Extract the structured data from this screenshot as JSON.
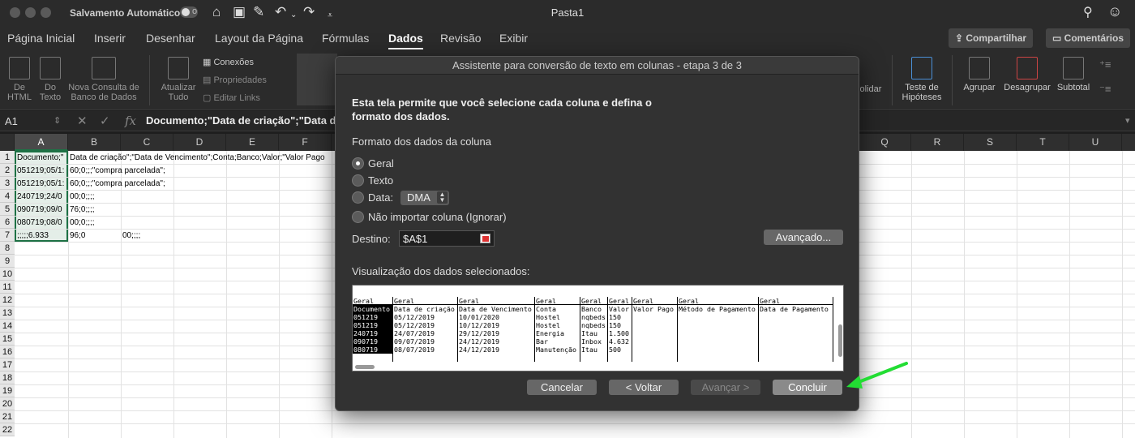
{
  "titlebar": {
    "autosave_label": "Salvamento Automático",
    "autosave_state": "o",
    "doc_title": "Pasta1"
  },
  "tabs": [
    "Página Inicial",
    "Inserir",
    "Desenhar",
    "Layout da Página",
    "Fórmulas",
    "Dados",
    "Revisão",
    "Exibir"
  ],
  "active_tab": "Dados",
  "top_buttons": {
    "share": "Compartilhar",
    "comments": "Comentários"
  },
  "ribbon": {
    "from_html": "De\nHTML",
    "from_text": "Do\nTexto",
    "new_query": "Nova Consulta de\nBanco de Dados",
    "refresh_all": "Atualizar\nTudo",
    "connections": "Conexões",
    "properties": "Propriedades",
    "edit_links": "Editar Links",
    "consolidate": "olidar",
    "whatif": "Teste de\nHipóteses",
    "group": "Agrupar",
    "ungroup": "Desagrupar",
    "subtotal": "Subtotal"
  },
  "formula_bar": {
    "name_box": "A1",
    "fx": "fx",
    "formula": "Documento;\"Data de criação\";\"Data de"
  },
  "columns": [
    "A",
    "B",
    "C",
    "D",
    "E",
    "F",
    "Q",
    "R",
    "S",
    "T",
    "U"
  ],
  "rows": [
    "1",
    "2",
    "3",
    "4",
    "5",
    "6",
    "7",
    "8",
    "9",
    "10",
    "11",
    "12",
    "13",
    "14",
    "15",
    "16",
    "17",
    "18",
    "19",
    "20",
    "21",
    "22"
  ],
  "cells": {
    "A1": "Documento;\"",
    "B1": "Data de criação\";\"Data de Vencimento\";Conta;Banco;Valor;\"Valor Pago",
    "A2": "051219;05/1:",
    "B2": "60;0;;;\"compra parcelada\";",
    "A3": "051219;05/1:",
    "B3": "60;0;;;\"compra parcelada\";",
    "A4": "240719;24/0",
    "B4": "00;0;;;;",
    "A5": "090719;09/0",
    "B5": "76;0;;;;",
    "A6": "080719;08/0",
    "B6": "00;0;;;;",
    "A7": ";;;;;6.933",
    "B7": "96;0",
    "C7": "00;;;;"
  },
  "dialog": {
    "title": "Assistente para conversão de texto em colunas - etapa 3 de 3",
    "description": "Esta tela permite que você selecione cada coluna e defina o formato dos dados.",
    "format_label": "Formato dos dados da coluna",
    "options": {
      "general": "Geral",
      "text": "Texto",
      "date": "Data:",
      "skip": "Não importar coluna (Ignorar)"
    },
    "selected_option": "Geral",
    "date_format": "DMA",
    "destination_label": "Destino:",
    "destination_value": "$A$1",
    "advanced_button": "Avançado...",
    "preview_label": "Visualização dos dados selecionados:",
    "preview": {
      "columns": [
        {
          "header": "Geral",
          "cells": [
            "Documento",
            "051219",
            "051219",
            "240719",
            "090719",
            "080719"
          ]
        },
        {
          "header": "Geral",
          "cells": [
            "Data de criação",
            "05/12/2019",
            "05/12/2019",
            "24/07/2019",
            "09/07/2019",
            "08/07/2019"
          ]
        },
        {
          "header": "Geral",
          "cells": [
            "Data de Vencimento",
            "10/01/2020",
            "10/12/2019",
            "29/12/2019",
            "24/12/2019",
            "24/12/2019"
          ]
        },
        {
          "header": "Geral",
          "cells": [
            "Conta",
            "Hostel",
            "Hostel",
            "Energia",
            "Bar",
            "Manutenção"
          ]
        },
        {
          "header": "Geral",
          "cells": [
            "Banco",
            "nqbeds",
            "nqbeds",
            "Itau",
            "Inbox",
            "Itau"
          ]
        },
        {
          "header": "Geral",
          "cells": [
            "Valor",
            "150",
            "150",
            "1.500",
            "4.632",
            "500"
          ]
        },
        {
          "header": "Geral",
          "cells": [
            "Valor Pago",
            "",
            "",
            "",
            "",
            ""
          ]
        },
        {
          "header": "Geral",
          "cells": [
            "Método de Pagamento",
            "",
            "",
            "",
            "",
            ""
          ]
        },
        {
          "header": "Geral",
          "cells": [
            "Data de Pagamento",
            "",
            "",
            "",
            "",
            ""
          ]
        }
      ]
    },
    "buttons": {
      "cancel": "Cancelar",
      "back": "< Voltar",
      "next": "Avançar >",
      "finish": "Concluir"
    }
  },
  "accent_colors": {
    "selection": "#1e7145",
    "annotation_arrow": "#22dd33"
  }
}
